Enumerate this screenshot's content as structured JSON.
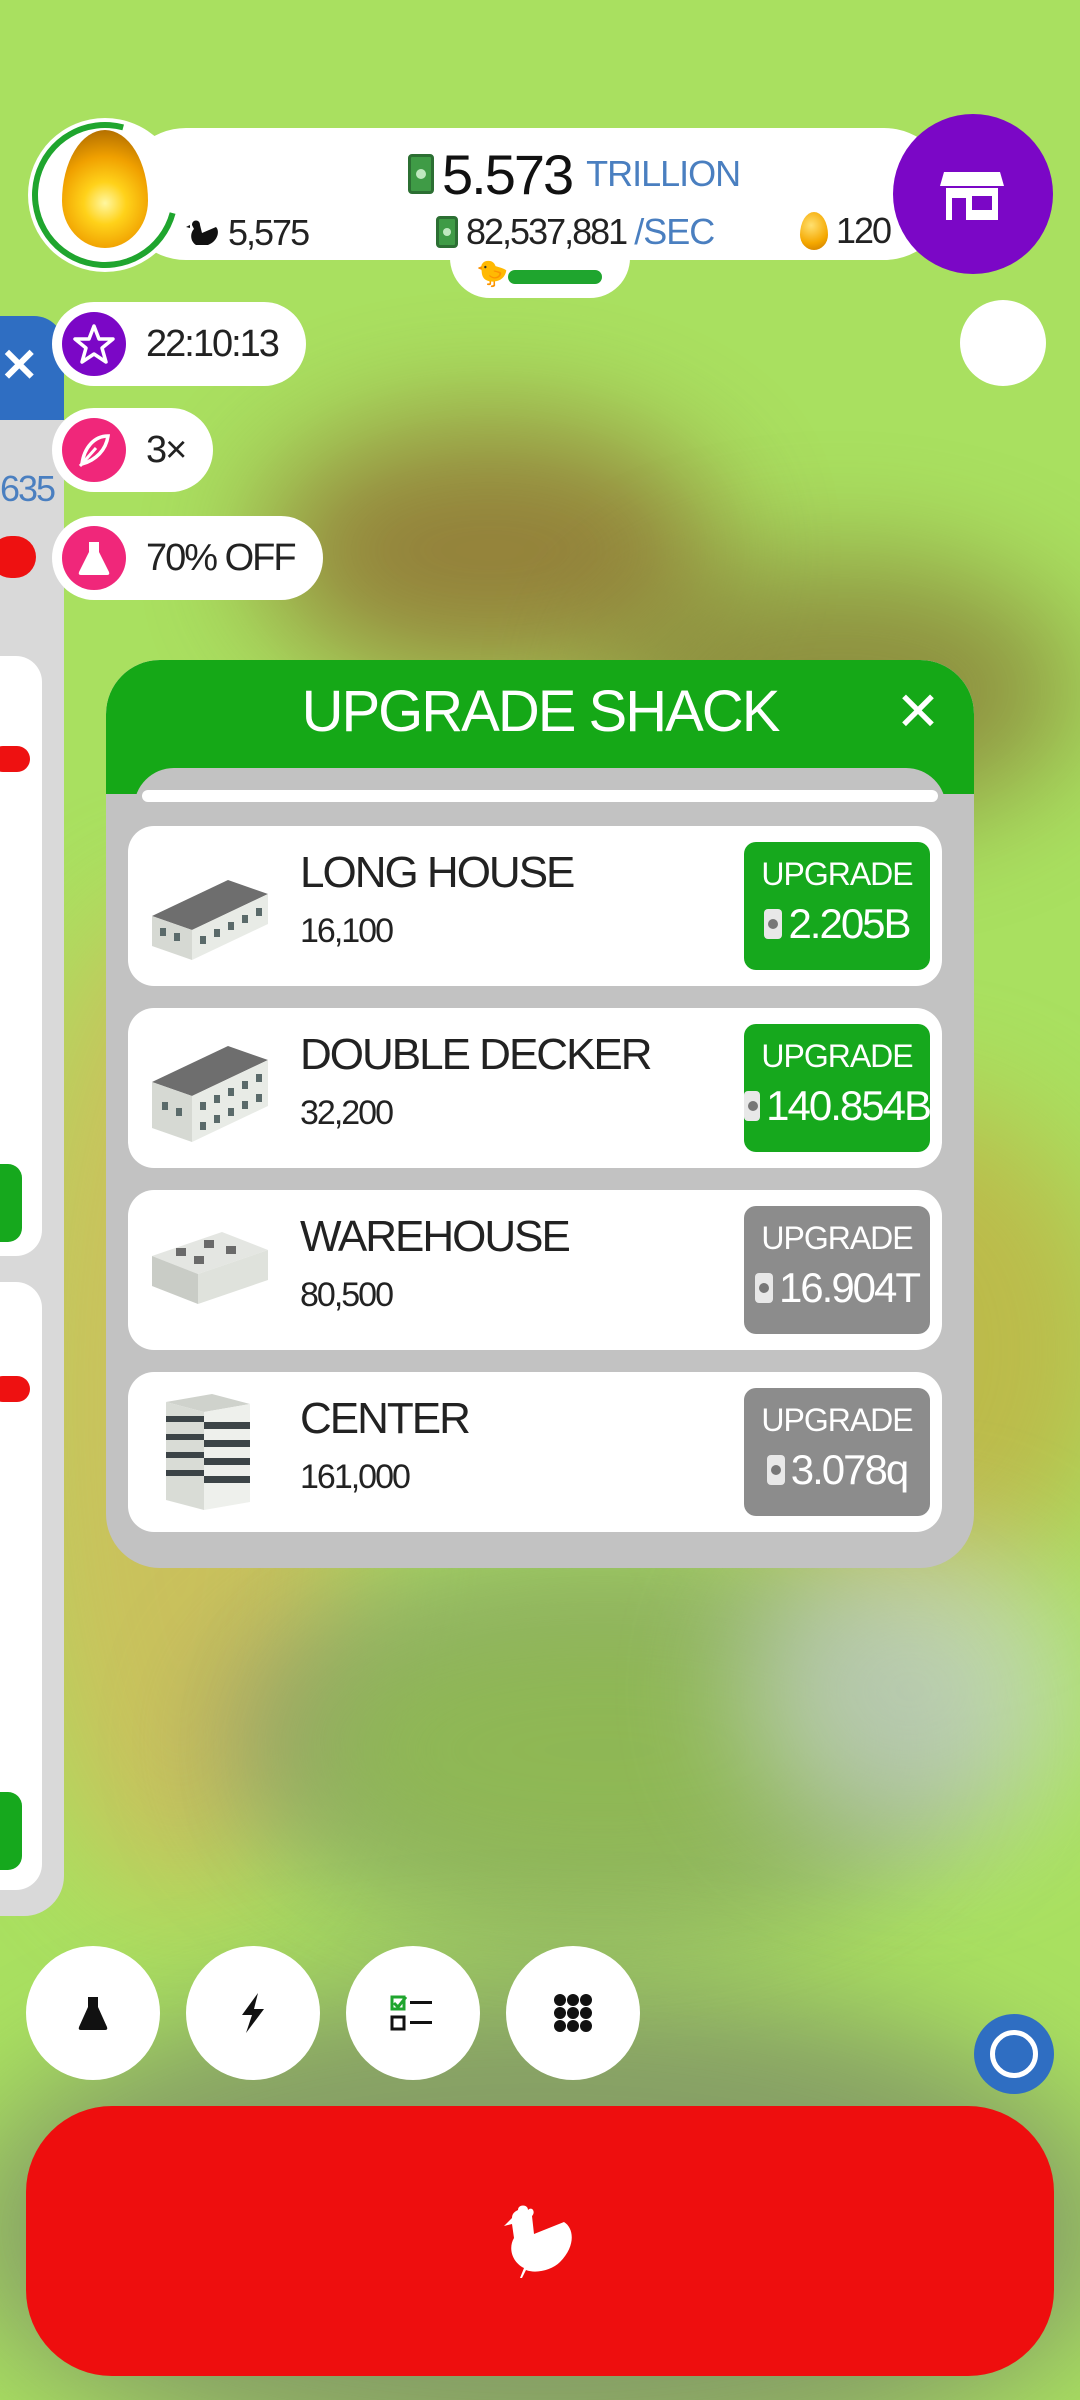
{
  "hud": {
    "cash_amount": "5.573",
    "cash_unit": "TRILLION",
    "rate_amount": "82,537,881",
    "rate_unit": "/SEC",
    "chicken_count": "5,575",
    "golden_eggs": "120"
  },
  "boosts": [
    {
      "icon": "star-icon",
      "text": "22:10:13",
      "color": "#7b07c6"
    },
    {
      "icon": "feather-icon",
      "text": "3×",
      "color": "#f0277a"
    },
    {
      "icon": "flask-icon",
      "text": "70% OFF",
      "color": "#f0277a"
    }
  ],
  "side_panel": {
    "partial_number": "635"
  },
  "modal": {
    "title": "UPGRADE SHACK",
    "close": "✕",
    "rows": [
      {
        "name": "LONG HOUSE",
        "capacity": "16,100",
        "button_label": "UPGRADE",
        "price": "2.205B",
        "state": "active"
      },
      {
        "name": "DOUBLE DECKER",
        "capacity": "32,200",
        "button_label": "UPGRADE",
        "price": "140.854B",
        "state": "active"
      },
      {
        "name": "WAREHOUSE",
        "capacity": "80,500",
        "button_label": "UPGRADE",
        "price": "16.904T",
        "state": "locked"
      },
      {
        "name": "CENTER",
        "capacity": "161,000",
        "button_label": "UPGRADE",
        "price": "3.078q",
        "state": "locked"
      }
    ]
  },
  "bottom_bar": {
    "buttons": [
      "research-button",
      "boost-button",
      "missions-button",
      "menu-button"
    ]
  },
  "colors": {
    "shop": "#7b07c6",
    "header_green": "#15a817",
    "hatch_red": "#ee0e0e",
    "accent_blue": "#4a7fc0"
  }
}
